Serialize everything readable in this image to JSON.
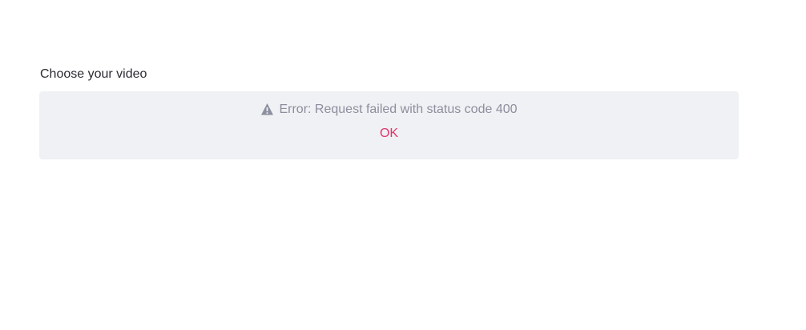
{
  "upload": {
    "label": "Choose your video"
  },
  "error": {
    "icon": "warning-icon",
    "message": "Error: Request failed with status code 400",
    "ok_label": "OK"
  },
  "colors": {
    "panel_background": "#f0f1f4",
    "message_text": "#8c8f9e",
    "accent": "#e0356b"
  }
}
